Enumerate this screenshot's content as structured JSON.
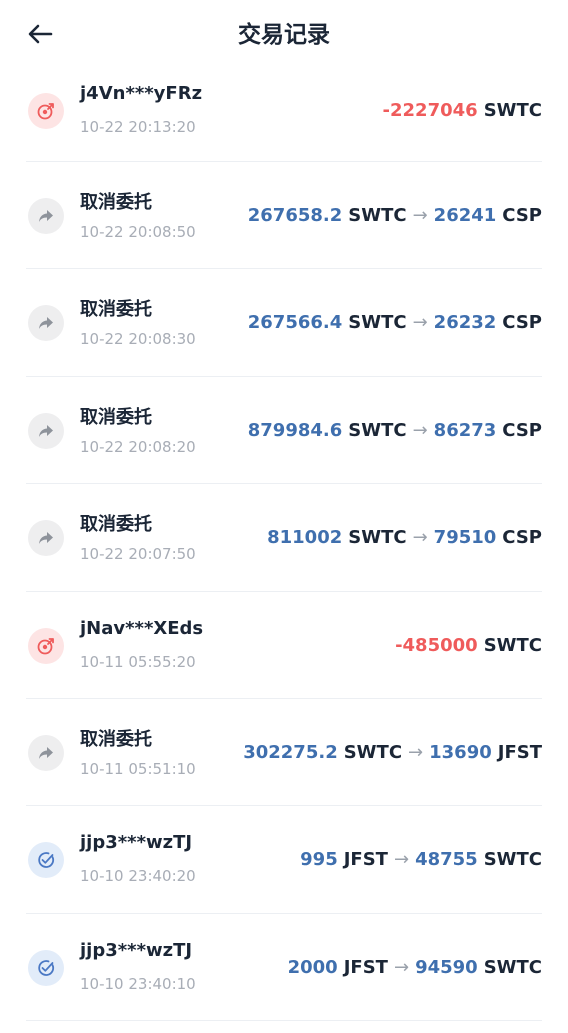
{
  "header": {
    "title": "交易记录",
    "back_icon": "arrow-left-icon"
  },
  "colors": {
    "negative": "#ef5b5b",
    "value_blue": "#3f6fae",
    "text_dark": "#1b2636",
    "text_muted": "#a8adb6"
  },
  "transactions": [
    {
      "type": "send",
      "icon": "send-target-icon",
      "name": "j4Vn***yFRz",
      "time": "10-22 20:13:20",
      "amount": "-2227046",
      "currency": "SWTC"
    },
    {
      "type": "cancel",
      "icon": "share-forward-icon",
      "name": "取消委托",
      "time": "10-22 20:08:50",
      "from_amount": "267658.2",
      "from_currency": "SWTC",
      "to_amount": "26241",
      "to_currency": "CSP"
    },
    {
      "type": "cancel",
      "icon": "share-forward-icon",
      "name": "取消委托",
      "time": "10-22 20:08:30",
      "from_amount": "267566.4",
      "from_currency": "SWTC",
      "to_amount": "26232",
      "to_currency": "CSP"
    },
    {
      "type": "cancel",
      "icon": "share-forward-icon",
      "name": "取消委托",
      "time": "10-22 20:08:20",
      "from_amount": "879984.6",
      "from_currency": "SWTC",
      "to_amount": "86273",
      "to_currency": "CSP"
    },
    {
      "type": "cancel",
      "icon": "share-forward-icon",
      "name": "取消委托",
      "time": "10-22 20:07:50",
      "from_amount": "811002",
      "from_currency": "SWTC",
      "to_amount": "79510",
      "to_currency": "CSP"
    },
    {
      "type": "send",
      "icon": "send-target-icon",
      "name": "jNav***XEds",
      "time": "10-11 05:55:20",
      "amount": "-485000",
      "currency": "SWTC"
    },
    {
      "type": "cancel",
      "icon": "share-forward-icon",
      "name": "取消委托",
      "time": "10-11 05:51:10",
      "from_amount": "302275.2",
      "from_currency": "SWTC",
      "to_amount": "13690",
      "to_currency": "JFST"
    },
    {
      "type": "receive",
      "icon": "check-circle-icon",
      "name": "jjp3***wzTJ",
      "time": "10-10 23:40:20",
      "from_amount": "995",
      "from_currency": "JFST",
      "to_amount": "48755",
      "to_currency": "SWTC"
    },
    {
      "type": "receive",
      "icon": "check-circle-icon",
      "name": "jjp3***wzTJ",
      "time": "10-10 23:40:10",
      "from_amount": "2000",
      "from_currency": "JFST",
      "to_amount": "94590",
      "to_currency": "SWTC"
    }
  ]
}
